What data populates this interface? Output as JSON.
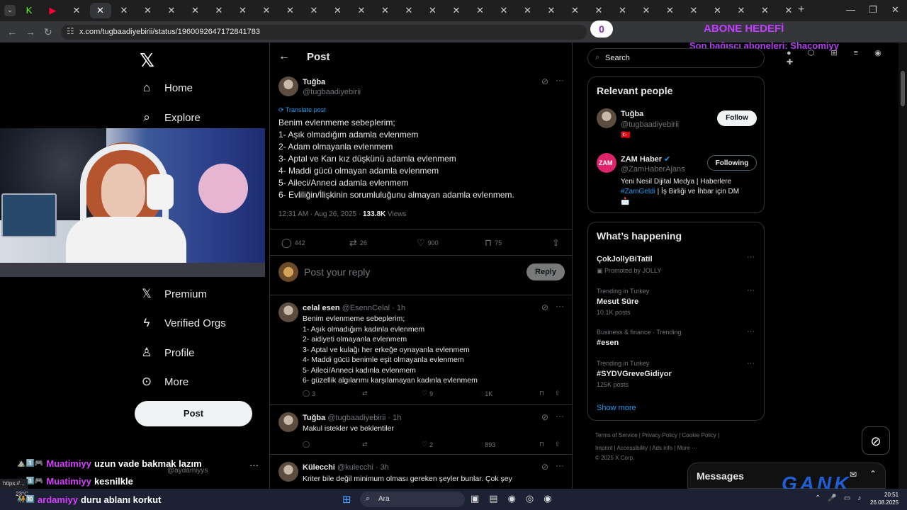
{
  "browser": {
    "tab_icons": [
      "K",
      "▶",
      "✕",
      "✕",
      "✕",
      "✕",
      "✕",
      "✕",
      "✕",
      "✕",
      "✕",
      "✕",
      "✕",
      "✕",
      "✕",
      "✕",
      "✕",
      "✕",
      "✕",
      "✕",
      "✕",
      "✕",
      "✕",
      "✕",
      "✕",
      "✕",
      "✕",
      "✕",
      "✕",
      "✕",
      "✕",
      "✕",
      "✕"
    ],
    "url": "x.com/tugbaadiyebirii/status/1960092647172841783",
    "notification_count": "0"
  },
  "stream_overlay": {
    "goal_text": "ABONE HEDEFİ",
    "donor_text": "Son bağışçı aboneleri: Shacomiyy"
  },
  "nav": {
    "items": [
      {
        "label": "Home",
        "icon": "home-icon"
      },
      {
        "label": "Explore",
        "icon": "search-icon"
      },
      {
        "label": "Premium",
        "icon": "x-icon"
      },
      {
        "label": "Verified Orgs",
        "icon": "lightning-icon"
      },
      {
        "label": "Profile",
        "icon": "person-icon"
      },
      {
        "label": "More",
        "icon": "more-circle-icon"
      }
    ],
    "post_label": "Post"
  },
  "post": {
    "header_title": "Post",
    "author_name": "Tuğba",
    "author_handle": "@tugbaadiyebirii",
    "translate_label": "Translate post",
    "lines": [
      "Benim evlenmeme sebeplerim;",
      "1- Aşık olmadığım adamla evlenmem",
      "2- Adam olmayanla evlenmem",
      "3- Aptal ve Karı kız düşkünü adamla evlenmem",
      "4- Maddi gücü olmayan adamla evlenmem",
      "5- Aileci/Anneci adamla evlenmem",
      "6- Evliliğin/İlişkinin sorumluluğunu almayan adamla evlenmem."
    ],
    "time": "12:31 AM · Aug 26, 2025 · ",
    "views_count": "133.8K",
    "views_label": " Views",
    "replies": "442",
    "reposts": "26",
    "likes": "900",
    "bookmarks": "75",
    "reply_placeholder": "Post your reply",
    "reply_button": "Reply"
  },
  "replies": [
    {
      "name": "celal esen",
      "handle": "@EsennCelal · 1h",
      "lines": [
        "Benim evlenmeme sebeplerim;",
        "1- Aşık olmadığım kadınla evlenmem",
        "2- aidiyeti olmayanla evlenmem",
        "3- Aptal ve kulağı her erkeğe oynayanla evlenmem",
        "4- Maddi gücü benimle eşit olmayanla evlenmem",
        "5- Aileci/Anneci kadınla evlenmem",
        "6- güzellik algılarımı karşılamayan kadınla evlenmem"
      ],
      "replies": "3",
      "reposts": "",
      "likes": "9",
      "views": "1K"
    },
    {
      "name": "Tuğba",
      "handle": "@tugbaadiyebirii · 1h",
      "lines": [
        "Makul istekler ve beklentiler"
      ],
      "replies": "",
      "reposts": "",
      "likes": "2",
      "views": "893"
    },
    {
      "name": "Külecchi",
      "handle": "@kulecchi · 3h",
      "lines": [
        "Kriter bile değil minimum olması gereken şeyler bunlar. Çok şey"
      ],
      "replies": "",
      "reposts": "",
      "likes": "",
      "views": ""
    }
  ],
  "right": {
    "search_placeholder": "Search",
    "relevant_title": "Relevant people",
    "people": [
      {
        "name": "Tuğba",
        "handle": "@tugbaadiyebirii",
        "bio": "",
        "flag": "🇹🇷",
        "button": "Follow"
      },
      {
        "name": "ZAM Haber",
        "handle": "@ZamHaberAjans",
        "bio_line1": "Yeni Nesil Dijital Medya | Haberlere",
        "bio_tag": "#ZamGeldi",
        "bio_line2_rest": " | İş Birliği ve İhbar için DM",
        "bio_line3": "📩",
        "button": "Following"
      }
    ],
    "happening_title": "What’s happening",
    "trends": [
      {
        "category": "",
        "name": "ÇokJollyBiTatil",
        "count": "Promoted by JOLLY"
      },
      {
        "category": "Trending in Turkey",
        "name": "Mesut Süre",
        "count": "10.1K posts"
      },
      {
        "category": "Business & finance · Trending",
        "name": "#esen",
        "count": ""
      },
      {
        "category": "Trending in Turkey",
        "name": "#SYDVGreveGidiyor",
        "count": "125K posts"
      }
    ],
    "show_more": "Show more",
    "footer_line1": "Terms of Service  |  Privacy Policy  |  Cookie Policy  |",
    "footer_line2": "Imprint  |  Accessibility  |  Ads info  |  More ···",
    "footer_line3": "© 2025 X Corp."
  },
  "messages": {
    "title": "Messages"
  },
  "gank": {
    "logo_text": "GANK"
  },
  "chat": [
    {
      "badges": "⛰️1️⃣🎮",
      "user": "Muatimiyy",
      "text": "uzun vade bakmak lazım"
    },
    {
      "badges": "⛰️1️⃣🎮",
      "user": "Muatimiyy",
      "text": "kesnilkle"
    },
    {
      "badges": "🧑‍🤝‍🧑🔟",
      "user": "ardamiyy",
      "text": "duru ablanı korkut"
    }
  ],
  "chat_ghost": "@aydamiyys",
  "status_url": "https://...",
  "taskbar": {
    "weather": "23°C",
    "search_label": "Ara",
    "time": "20:51",
    "date": "26.08.2025"
  }
}
